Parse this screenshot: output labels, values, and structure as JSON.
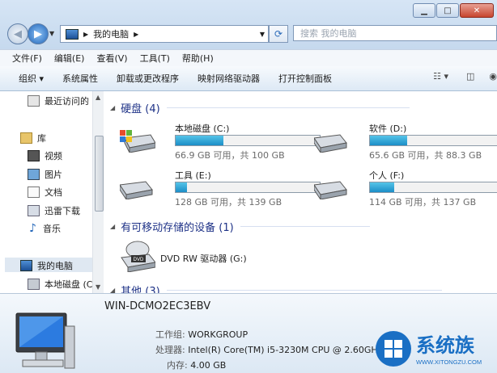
{
  "window": {
    "minimize": "▁",
    "maximize": "□",
    "close": "✕"
  },
  "address": {
    "path": "我的电脑",
    "search_placeholder": "搜索 我的电脑"
  },
  "menu": [
    "文件(F)",
    "编辑(E)",
    "查看(V)",
    "工具(T)",
    "帮助(H)"
  ],
  "toolbar": [
    "组织 ▾",
    "系统属性",
    "卸载或更改程序",
    "映射网络驱动器",
    "打开控制面板"
  ],
  "nav": {
    "recent": "最近访问的",
    "library": "库",
    "video": "视频",
    "pictures": "图片",
    "documents": "文档",
    "thunder": "迅雷下载",
    "music": "音乐",
    "computer": "我的电脑",
    "local_disk": "本地磁盘 (C"
  },
  "groups": {
    "hdd": "硬盘 (4)",
    "removable": "有可移动存储的设备 (1)",
    "other": "其他 (3)"
  },
  "drives": [
    {
      "name": "本地磁盘 (C:)",
      "size": "66.9 GB 可用，共 100 GB",
      "used": 0.331
    },
    {
      "name": "软件 (D:)",
      "size": "65.6 GB 可用，共 88.3 GB",
      "used": 0.257
    },
    {
      "name": "工具 (E:)",
      "size": "128 GB 可用，共 139 GB",
      "used": 0.079
    },
    {
      "name": "个人 (F:)",
      "size": "114 GB 可用，共 137 GB",
      "used": 0.168
    }
  ],
  "dvd": {
    "name": "DVD RW 驱动器 (G:)",
    "label": "DVD"
  },
  "details": {
    "pc_name": "WIN-DCMO2EC3EBV",
    "workgroup_label": "工作组:",
    "workgroup": "WORKGROUP",
    "cpu_label": "处理器:",
    "cpu": "Intel(R) Core(TM) i5-3230M CPU @ 2.60GHz",
    "mem_label": "内存:",
    "mem": "4.00 GB"
  },
  "watermark": {
    "title": "系统族",
    "url": "WWW.XITONGZU.COM"
  },
  "colors": {
    "accent": "#1e3287",
    "bar_fill": "#1c8ec7",
    "logo_blue": "#1a6fc4"
  }
}
